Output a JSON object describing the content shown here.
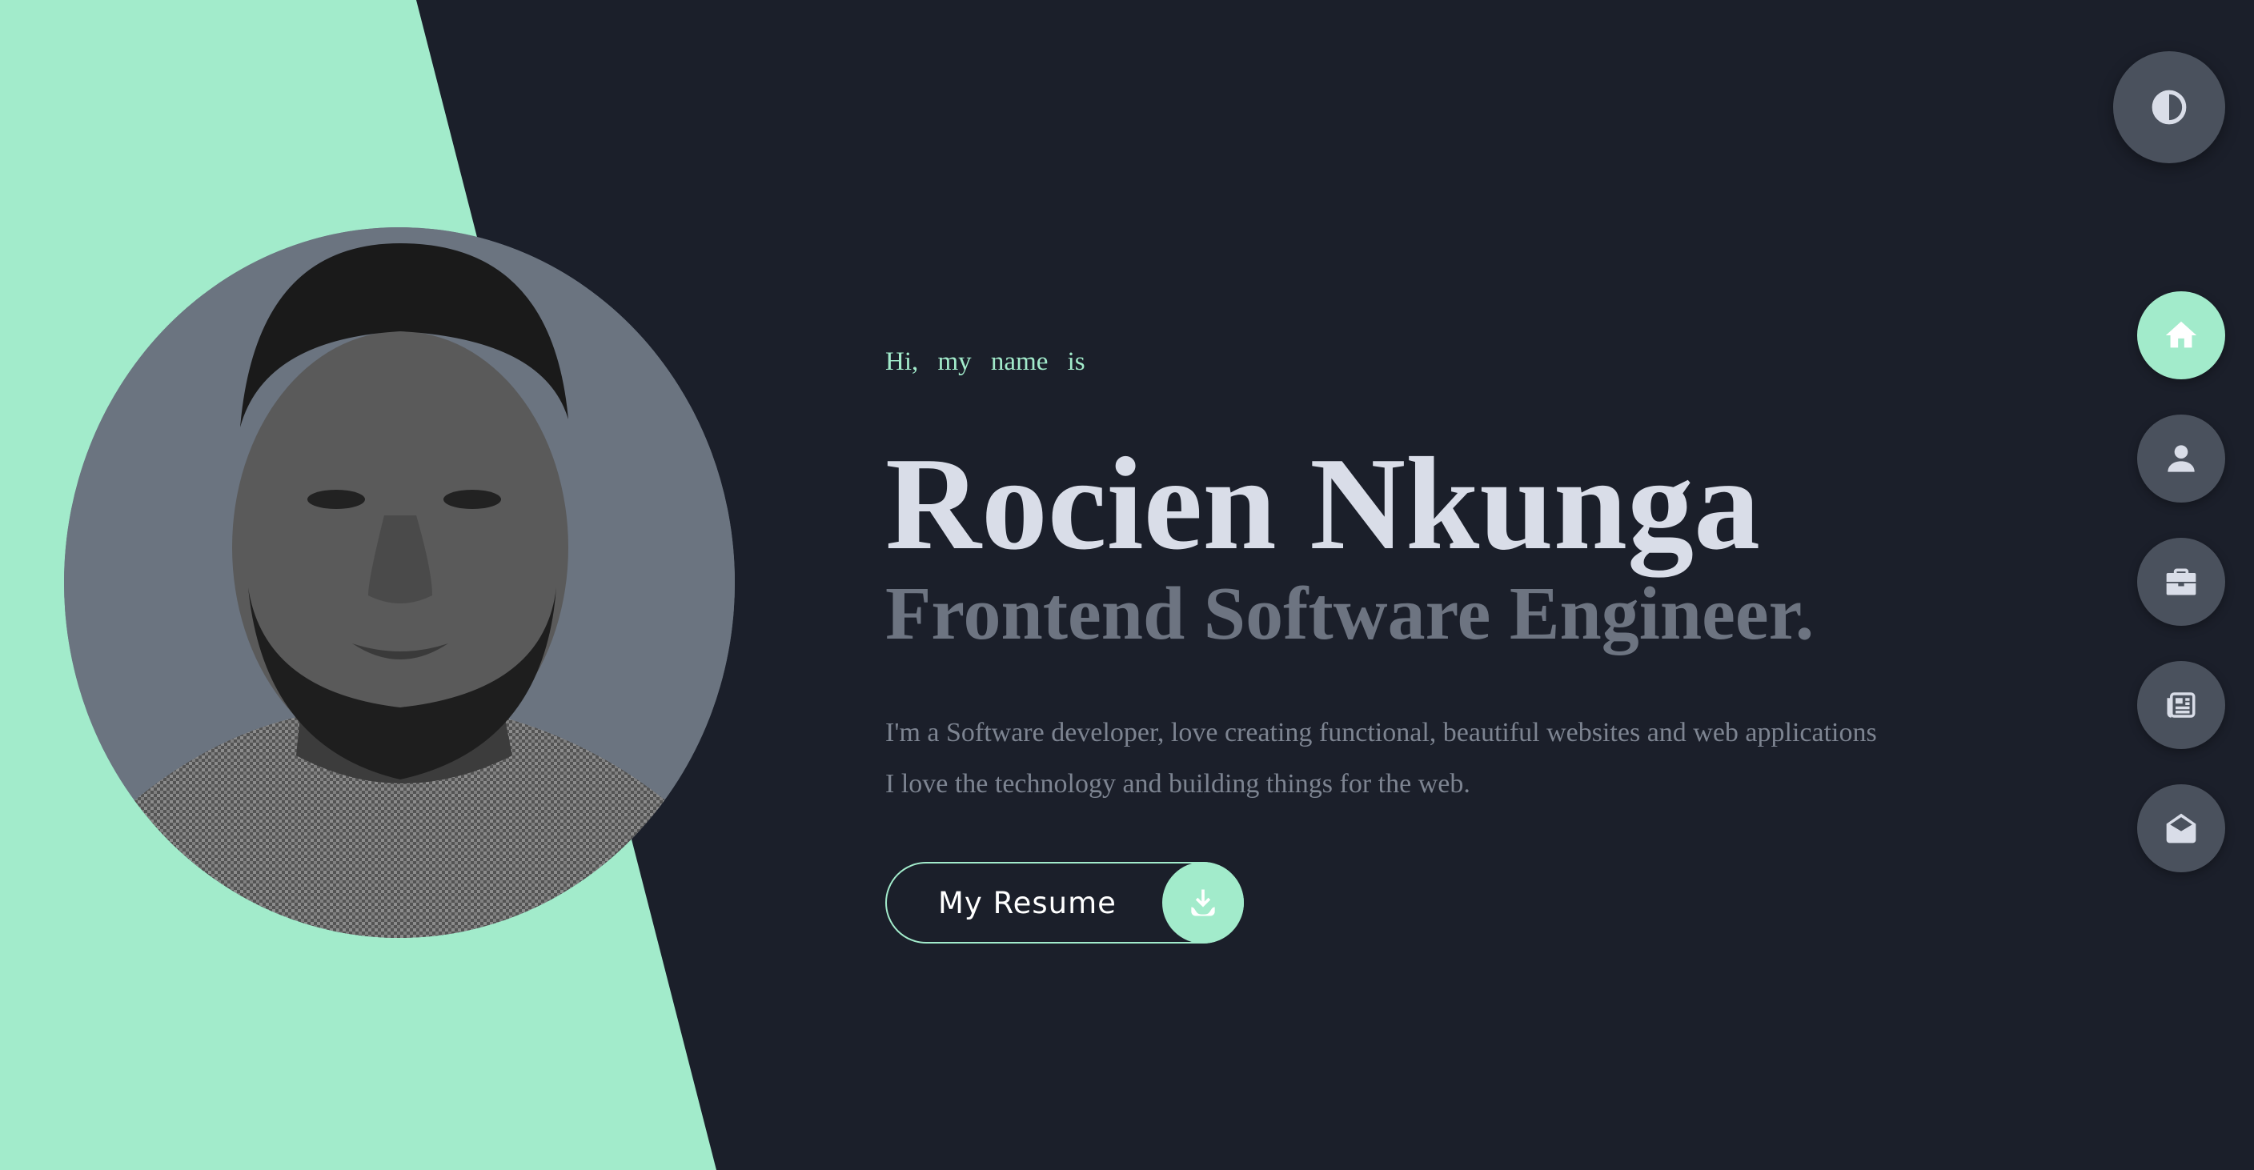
{
  "colors": {
    "background": "#1b1f2a",
    "accent": "#a2ebcb",
    "name_text": "#d9dde8",
    "title_text": "#6d7481",
    "nav_button": "#4a515d"
  },
  "hero": {
    "greeting": "Hi, my name is",
    "name": "Rocien Nkunga",
    "title": "Frontend Software Engineer.",
    "bio_line_1": "I'm a Software developer, love creating functional, beautiful websites and web applications",
    "bio_line_2": "I love the technology and building things for the web."
  },
  "resume_button": {
    "label": "My Resume",
    "icon": "download-icon"
  },
  "theme_toggle": {
    "icon": "contrast-icon"
  },
  "nav": {
    "items": [
      {
        "icon": "home-icon",
        "active": true
      },
      {
        "icon": "user-icon",
        "active": false
      },
      {
        "icon": "briefcase-icon",
        "active": false
      },
      {
        "icon": "newspaper-icon",
        "active": false
      },
      {
        "icon": "envelope-open-icon",
        "active": false
      }
    ]
  }
}
